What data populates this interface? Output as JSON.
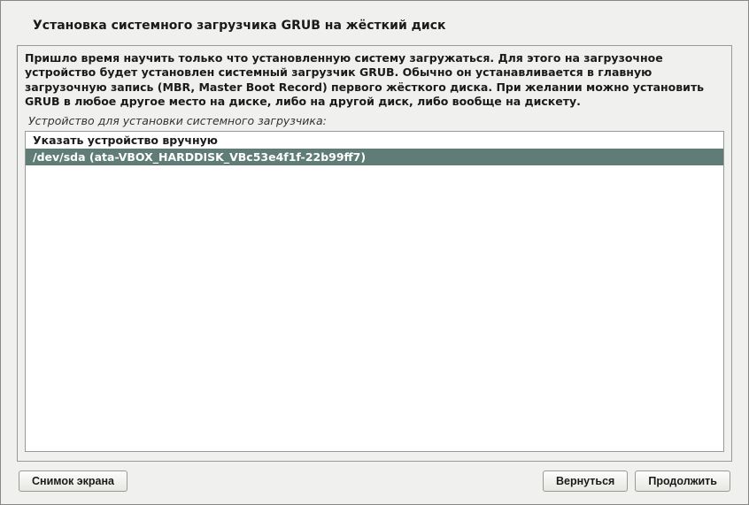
{
  "title": "Установка системного загрузчика GRUB на жёсткий диск",
  "description": "Пришло время научить только что установленную систему загружаться. Для этого на загрузочное устройство будет установлен системный загрузчик GRUB. Обычно он устанавливается в главную загрузочную запись (MBR, Master Boot Record) первого жёсткого диска. При желании можно установить GRUB в любое другое место на диске, либо на другой диск, либо вообще на дискету.",
  "subtitle": "Устройство для установки системного загрузчика:",
  "list": {
    "items": [
      {
        "label": "Указать устройство вручную",
        "selected": false
      },
      {
        "label": "/dev/sda  (ata-VBOX_HARDDISK_VBc53e4f1f-22b99ff7)",
        "selected": true
      }
    ]
  },
  "buttons": {
    "screenshot": "Снимок экрана",
    "back": "Вернуться",
    "continue": "Продолжить"
  }
}
